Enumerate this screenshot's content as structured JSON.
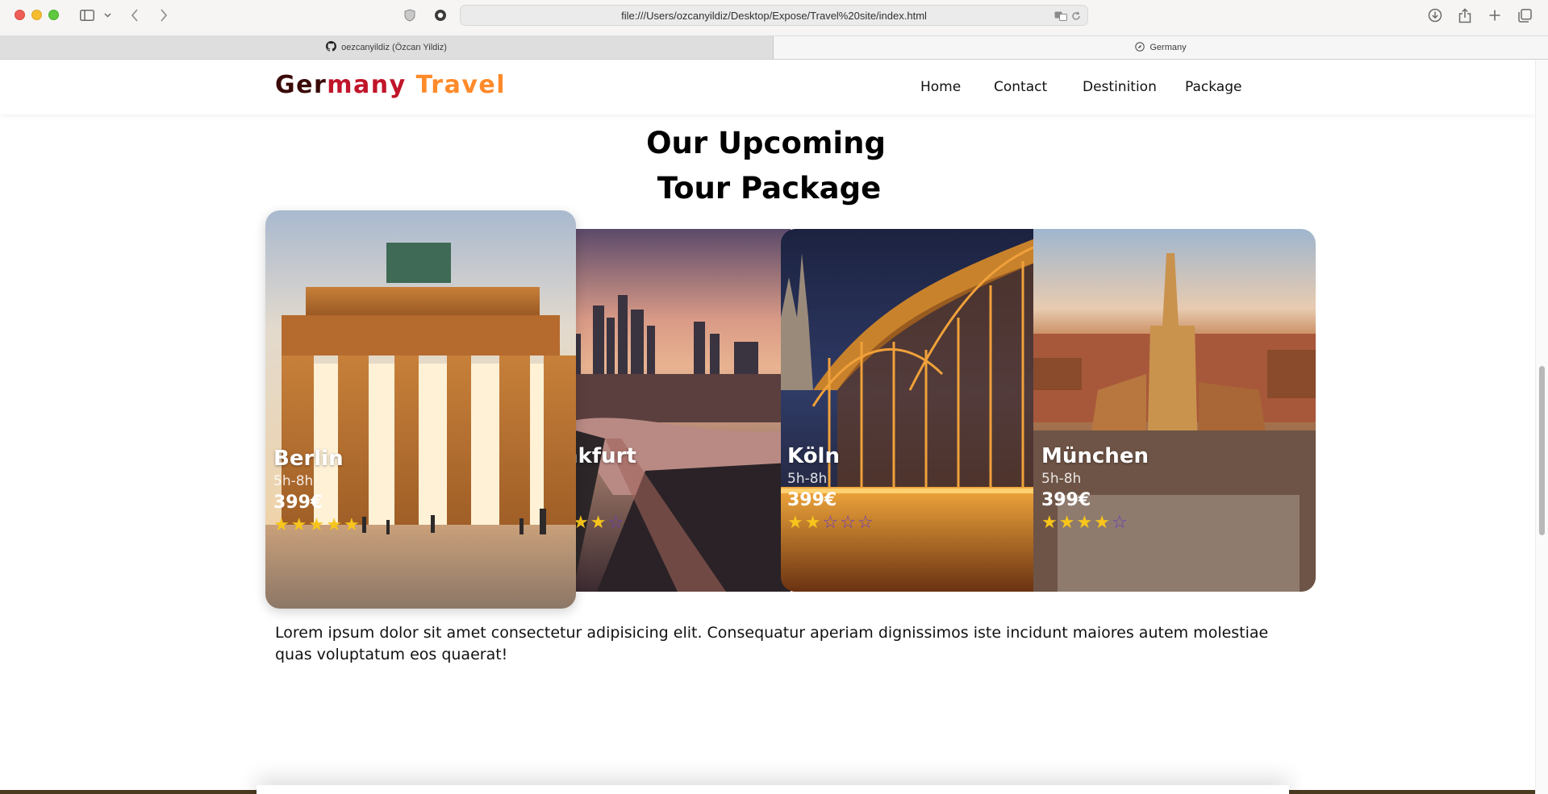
{
  "browser": {
    "address_url": "file:///Users/ozcanyildiz/Desktop/Expose/Travel%20site/index.html",
    "tabs": [
      {
        "label": "oezcanyildiz (Özcan Yildiz)",
        "icon": "github-icon"
      },
      {
        "label": "Germany",
        "icon": "compass-icon"
      }
    ]
  },
  "nav": {
    "logo_part1": "Ger",
    "logo_part2": "many",
    "logo_part3": " Travel",
    "links": [
      "Home",
      "Contact",
      "Destinition",
      "Package"
    ]
  },
  "section": {
    "title_line1": "Our Upcoming",
    "title_line2": "Tour Package"
  },
  "cards": [
    {
      "name": "Berlin",
      "duration": "5h-8h",
      "price": "399€",
      "rating": 5
    },
    {
      "name": "nkfurt",
      "duration": "",
      "price": "",
      "rating": 2
    },
    {
      "name": "Köln",
      "duration": "5h-8h",
      "price": "399€",
      "rating": 2
    },
    {
      "name": "München",
      "duration": "5h-8h",
      "price": "399€",
      "rating": 4
    }
  ],
  "stars": {
    "filled": "★",
    "empty": "☆"
  },
  "paragraph": "Lorem ipsum dolor sit amet consectetur adipisicing elit. Consequatur aperiam dignissimos iste incidunt maiores autem molestiae quas voluptatum eos quaerat!",
  "colors": {
    "logo_dark": "#3a0a08",
    "logo_red": "#c0152a",
    "logo_orange": "#ff8a2a",
    "star": "#f7c51b"
  }
}
